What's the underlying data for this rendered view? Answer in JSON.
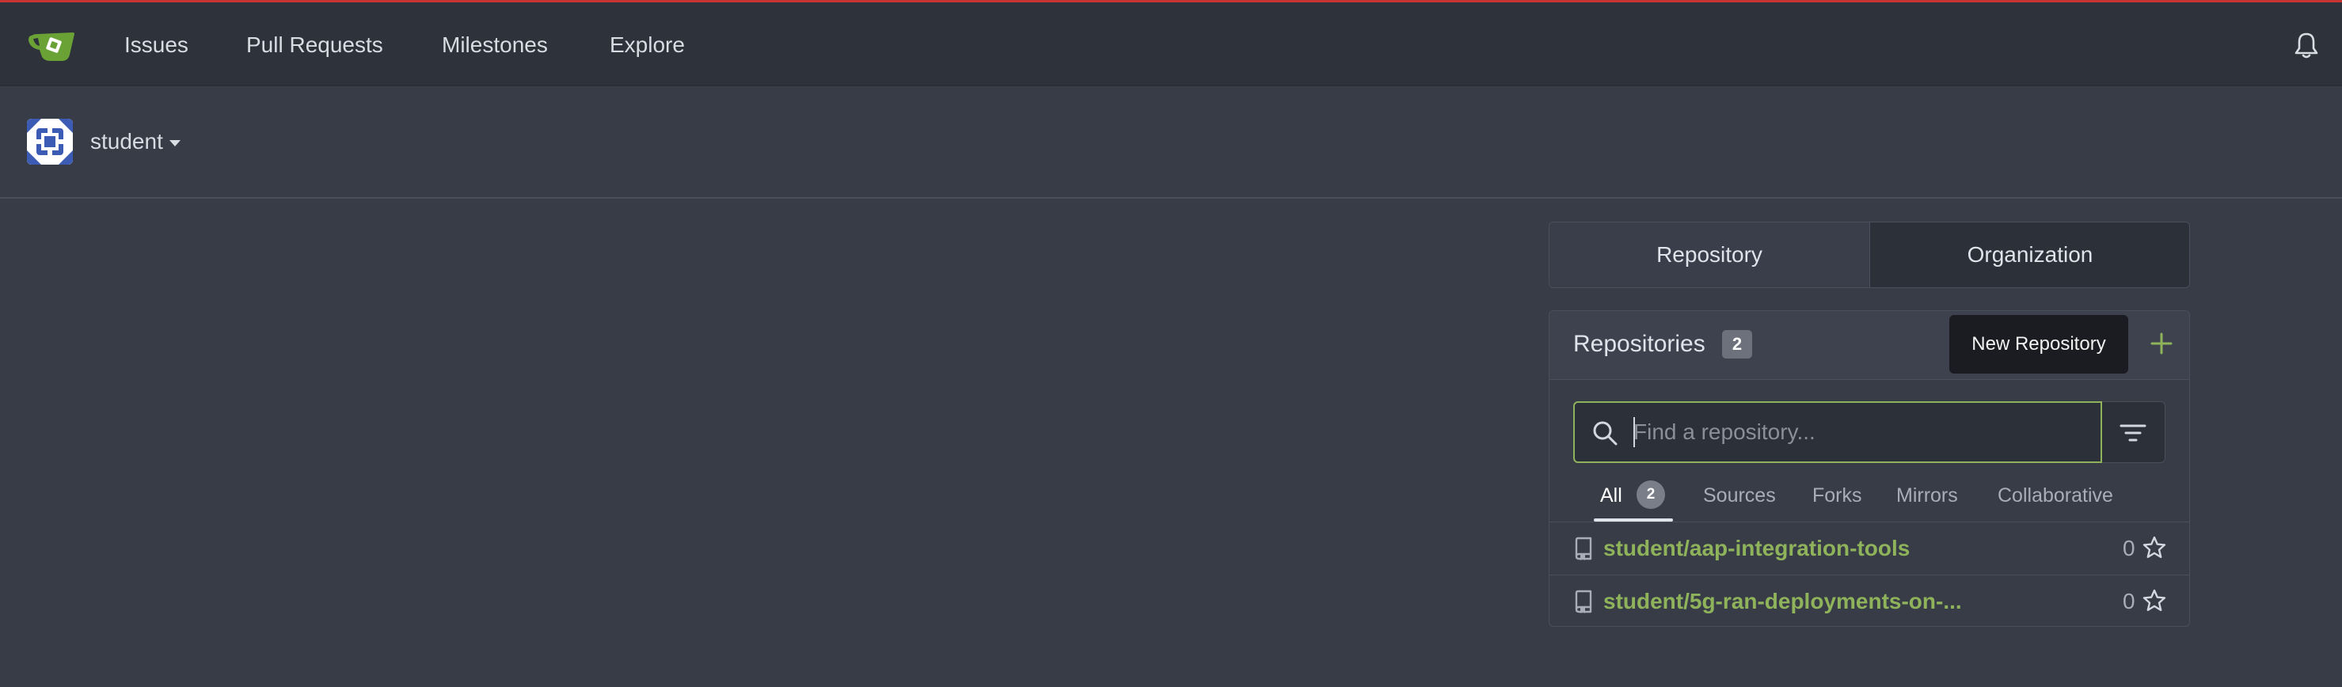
{
  "nav": {
    "items": [
      "Issues",
      "Pull Requests",
      "Milestones",
      "Explore"
    ]
  },
  "context": {
    "user": "student"
  },
  "switcher": {
    "repository": "Repository",
    "organization": "Organization"
  },
  "repos_panel": {
    "title": "Repositories",
    "count": "2",
    "tooltip": "New Repository",
    "search_placeholder": "Find a repository...",
    "filter_tabs": {
      "all": "All",
      "all_count": "2",
      "sources": "Sources",
      "forks": "Forks",
      "mirrors": "Mirrors",
      "collaborative": "Collaborative"
    },
    "repos": [
      {
        "name": "student/aap-integration-tools",
        "stars": "0"
      },
      {
        "name": "student/5g-ran-deployments-on-...",
        "stars": "0"
      }
    ]
  },
  "colors": {
    "accent": "#8fb35b",
    "navbar": "#2e323b",
    "background": "#383c47",
    "top_line": "#c83333"
  }
}
